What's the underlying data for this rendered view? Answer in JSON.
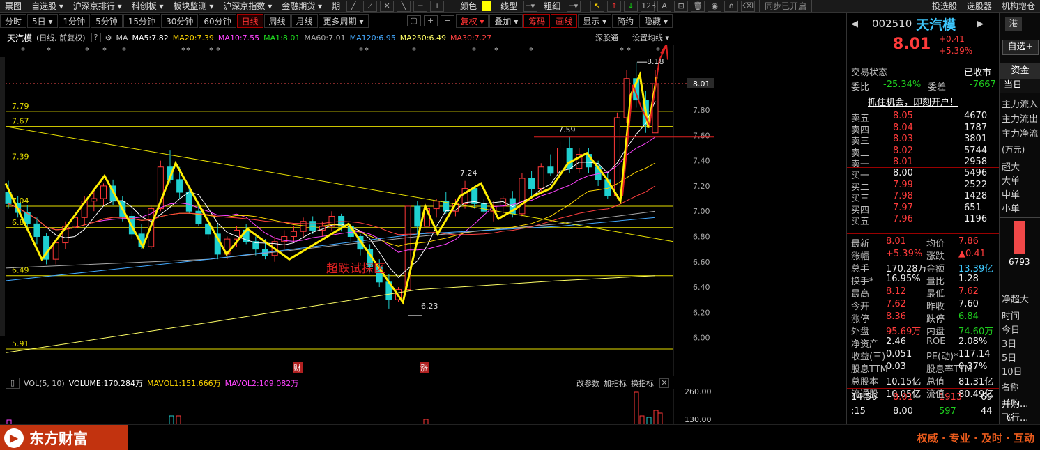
{
  "menubar": {
    "items": [
      "票图",
      "自选股 ▾",
      "沪深京排行 ▾",
      "科创板 ▾",
      "板块监测 ▾",
      "沪深京指数 ▾",
      "金融期货 ▾",
      "期"
    ],
    "color_label": "颜色",
    "line_label": "线型",
    "thick_label": "粗细",
    "sync_label": "同步已开启",
    "right_items": [
      "投选股",
      "选股器",
      "机构增仓"
    ]
  },
  "tabs": [
    "分时",
    "5日 ▾",
    "1分钟",
    "5分钟",
    "15分钟",
    "30分钟",
    "60分钟",
    "日线",
    "周线",
    "月线",
    "更多周期 ▾"
  ],
  "active_tab": "日线",
  "tools": {
    "fuquan": "复权 ▾",
    "diejia": "叠加 ▾",
    "chouma": "筹码",
    "huaxian": "画线",
    "xianshi": "显示 ▾",
    "jianyue": "简约",
    "yincang": "隐藏 ▾"
  },
  "info": {
    "name": "天汽模",
    "mode": "(日线, 前复权)",
    "ma_label": "MA",
    "ma": [
      {
        "label": "MA5:7.82",
        "color": "#ffffff"
      },
      {
        "label": "MA20:7.39",
        "color": "#ffd700"
      },
      {
        "label": "MA10:7.55",
        "color": "#ff44ff"
      },
      {
        "label": "MA1:8.01",
        "color": "#20e020"
      },
      {
        "label": "MA60:7.01",
        "color": "#aaaaaa"
      },
      {
        "label": "MA120:6.95",
        "color": "#44aaff"
      },
      {
        "label": "MA250:6.49",
        "color": "#ffff66"
      },
      {
        "label": "MA30:7.27",
        "color": "#ff4040"
      }
    ],
    "shengutong": "深股通",
    "shezhi": "设置均线 ▾"
  },
  "chart": {
    "price_axis": [
      "8.01",
      "7.80",
      "7.60",
      "7.40",
      "7.20",
      "7.00",
      "6.80",
      "6.60",
      "6.40",
      "6.20",
      "6.00"
    ],
    "hlines": [
      {
        "label": "7.79",
        "v": 7.79
      },
      {
        "label": "7.67",
        "v": 7.67
      },
      {
        "label": "7.39",
        "v": 7.39
      },
      {
        "label": "7.04",
        "v": 7.04
      },
      {
        "label": "6.87",
        "v": 6.87
      },
      {
        "label": "6.49",
        "v": 6.49
      },
      {
        "label": "5.91",
        "v": 5.91
      }
    ],
    "annotations": {
      "high": "8.18",
      "low": "6.23",
      "a759": "7.59",
      "a724": "7.24",
      "zone": "超跌试探区",
      "cai": "财",
      "zhang": "涨"
    }
  },
  "volume": {
    "label": "VOL(5, 10)",
    "volume": "VOLUME:170.284万",
    "mavol1": "MAVOL1:151.666万",
    "mavol2": "MAVOL2:109.082万",
    "btn1": "改参数",
    "btn2": "加指标",
    "btn3": "换指标",
    "axis": [
      "260.00",
      "130.00"
    ]
  },
  "quote": {
    "code": "002510",
    "name": "天汽模",
    "price": "8.01",
    "change": "+0.41",
    "pct": "+5.39%",
    "status_label": "交易状态",
    "status": "已收市",
    "weibi_label": "委比",
    "weibi": "-25.34%",
    "weicha_label": "委差",
    "weicha": "-7667",
    "banner": "抓住机会，即刻开户！",
    "sells": [
      [
        "卖五",
        "8.05",
        "4670"
      ],
      [
        "卖四",
        "8.04",
        "1787"
      ],
      [
        "卖三",
        "8.03",
        "3801"
      ],
      [
        "卖二",
        "8.02",
        "5744"
      ],
      [
        "卖一",
        "8.01",
        "2958"
      ]
    ],
    "buys": [
      [
        "买一",
        "8.00",
        "5496"
      ],
      [
        "买二",
        "7.99",
        "2522"
      ],
      [
        "买三",
        "7.98",
        "1428"
      ],
      [
        "买四",
        "7.97",
        "651"
      ],
      [
        "买五",
        "7.96",
        "1196"
      ]
    ],
    "stats": [
      [
        "最新",
        "8.01",
        "均价",
        "7.86"
      ],
      [
        "涨幅",
        "+5.39%",
        "涨跌",
        "▲0.41"
      ],
      [
        "总手",
        "170.28万",
        "金额",
        "13.39亿"
      ],
      [
        "换手*",
        "16.95%",
        "量比",
        "1.28"
      ],
      [
        "最高",
        "8.12",
        "最低",
        "7.62"
      ],
      [
        "今开",
        "7.62",
        "昨收",
        "7.60"
      ],
      [
        "涨停",
        "8.36",
        "跌停",
        "6.84"
      ],
      [
        "外盘",
        "95.69万",
        "内盘",
        "74.60万"
      ],
      [
        "净资产",
        "2.46",
        "ROE",
        "2.08%"
      ],
      [
        "收益(三)",
        "0.051",
        "PE(动)*",
        "117.14"
      ],
      [
        "股息TTM",
        "0.03",
        "股息率TTM",
        "0.37%"
      ],
      [
        "总股本",
        "10.15亿",
        "总值",
        "81.31亿"
      ],
      [
        "流通股",
        "10.05亿",
        "流值",
        "80.49亿"
      ]
    ],
    "ticks": [
      [
        "14:56",
        "8.01",
        "1913",
        "69"
      ],
      [
        ":15",
        "8.00",
        "597",
        "44"
      ]
    ]
  },
  "far": {
    "top": "港",
    "zixuan": "自选+",
    "zijin": "资金",
    "dangri": "当日",
    "flows": [
      "主力流入",
      "主力流出",
      "主力净流"
    ],
    "unit": "(万元)",
    "sizes": [
      "超大",
      "大单",
      "中单",
      "小单"
    ],
    "bar_value": "6793",
    "jingchaoda": "净超大",
    "times": [
      "时间",
      "今日",
      "3日",
      "5日",
      "10日"
    ],
    "mingcheng": "名称",
    "news": [
      "并购...",
      "飞行..."
    ]
  },
  "footer": {
    "logo": "东方财富",
    "slogan": "权威 · 专业 · 及时 · 互动"
  }
}
